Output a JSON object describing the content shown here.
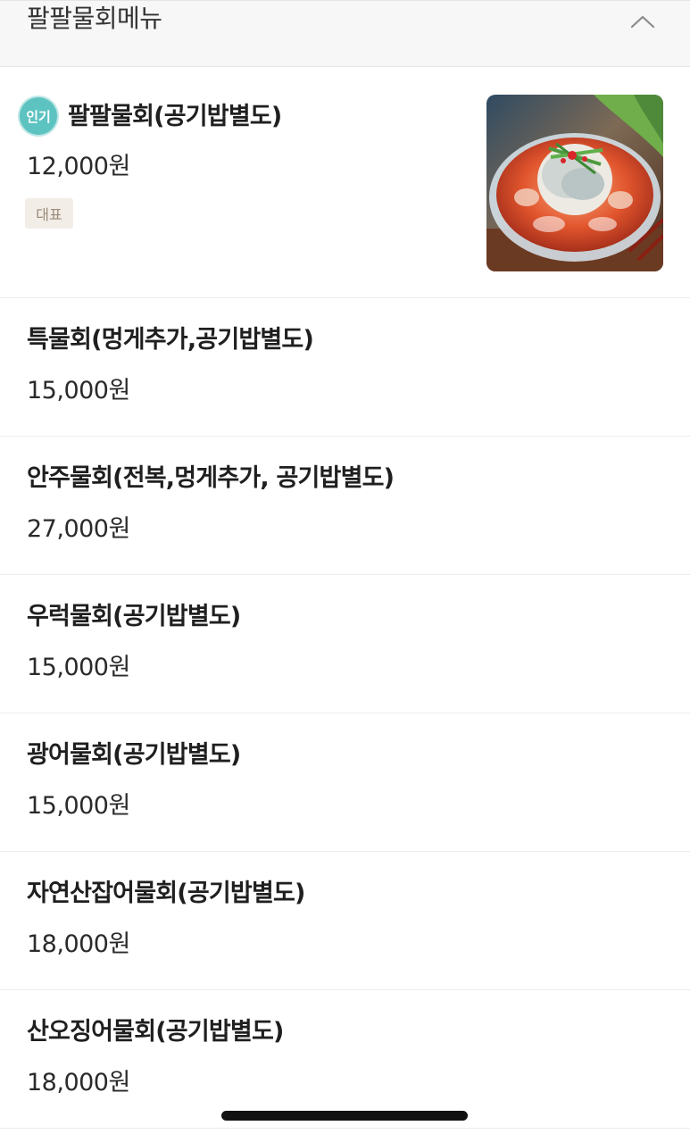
{
  "section": {
    "title": "팔팔물회메뉴",
    "collapse_icon": "chevron-up-icon"
  },
  "items": [
    {
      "name": "팔팔물회(공기밥별도)",
      "price": "12,000원",
      "badge": "인기",
      "tag": "대표",
      "has_image": true
    },
    {
      "name": "특물회(멍게추가,공기밥별도)",
      "price": "15,000원"
    },
    {
      "name": "안주물회(전복,멍게추가, 공기밥별도)",
      "price": "27,000원"
    },
    {
      "name": "우럭물회(공기밥별도)",
      "price": "15,000원"
    },
    {
      "name": "광어물회(공기밥별도)",
      "price": "15,000원"
    },
    {
      "name": "자연산잡어물회(공기밥별도)",
      "price": "18,000원"
    },
    {
      "name": "산오징어물회(공기밥별도)",
      "price": "18,000원"
    }
  ],
  "colors": {
    "badge": "#5cc3c1",
    "tag_bg": "#f2ede7",
    "tag_text": "#9b8a78"
  }
}
